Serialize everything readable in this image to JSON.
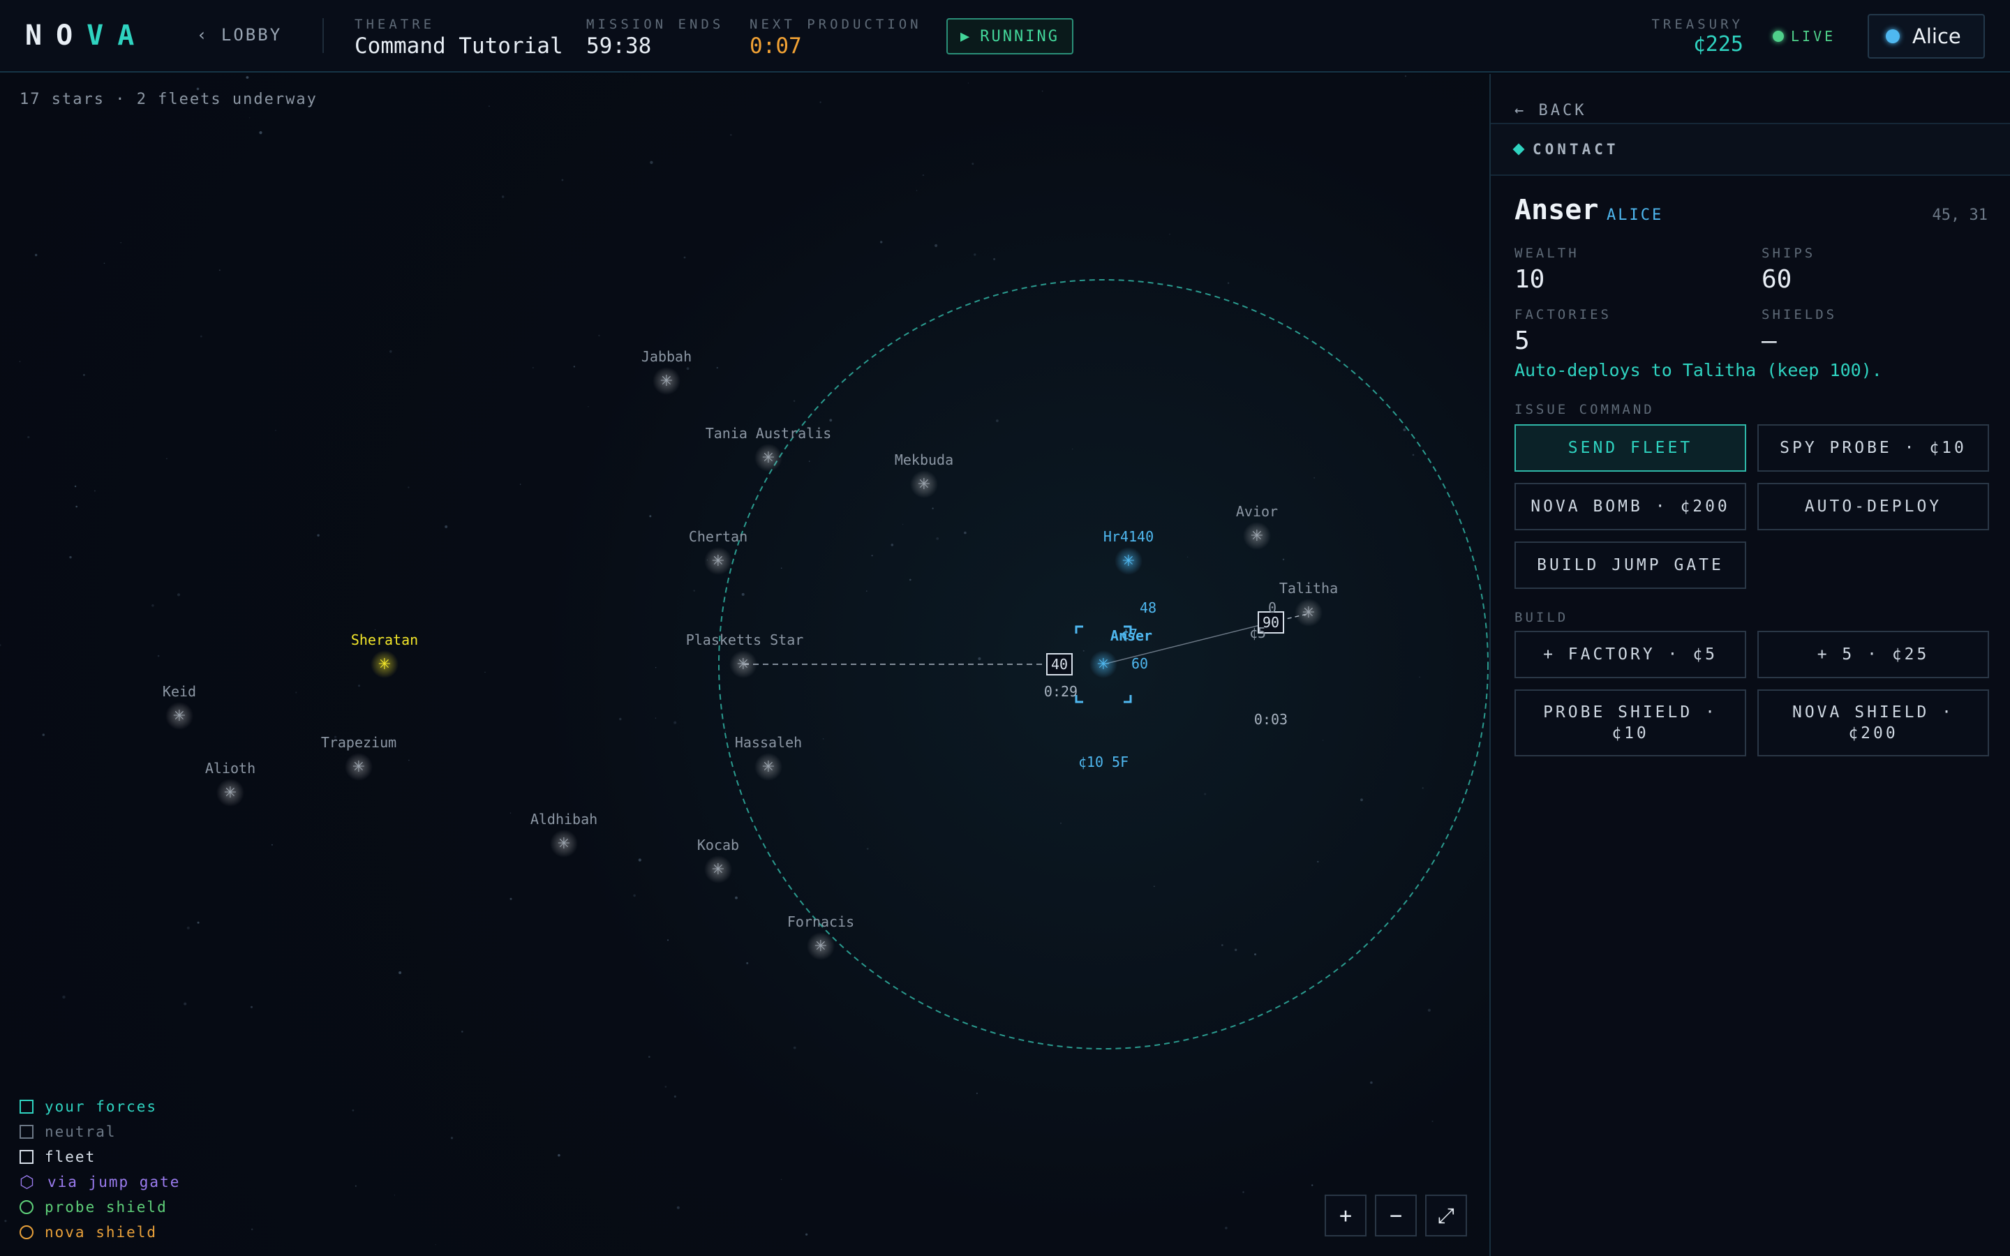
{
  "header": {
    "logo_a": "NO",
    "logo_b": "VA",
    "lobby_label": "‹ LOBBY",
    "theatre_label": "THEATRE",
    "theatre_value": "Command Tutorial",
    "mission_label": "MISSION ENDS",
    "mission_value": "59:38",
    "production_label": "NEXT PRODUCTION",
    "production_value": "0:07",
    "running_icon": "▶",
    "running_label": "RUNNING",
    "treasury_label": "TREASURY",
    "treasury_value": "¢225",
    "live_label": "LIVE",
    "user_name": "Alice"
  },
  "map": {
    "summary": "17 stars · 2 fleets underway",
    "stars": [
      {
        "name": "Jabbah"
      },
      {
        "name": "Tania Australis"
      },
      {
        "name": "Mekbuda"
      },
      {
        "name": "Chertan"
      },
      {
        "name": "Hr4140",
        "ships": "48",
        "wealth": "¢7"
      },
      {
        "name": "Avior",
        "ships": "0",
        "wealth": "¢5"
      },
      {
        "name": "Talitha"
      },
      {
        "name": "Sheratan"
      },
      {
        "name": "Plasketts Star"
      },
      {
        "name": "Anser",
        "ships": "60",
        "info": "¢10 5F"
      },
      {
        "name": "Keid"
      },
      {
        "name": "Trapezium"
      },
      {
        "name": "Alioth"
      },
      {
        "name": "Hassaleh"
      },
      {
        "name": "Aldhibah"
      },
      {
        "name": "Kocab"
      },
      {
        "name": "Fornacis"
      }
    ],
    "fleets": [
      {
        "ships": "40",
        "eta": "0:29"
      },
      {
        "ships": "90",
        "eta": "0:03"
      }
    ],
    "legend": [
      {
        "label": "your forces",
        "color": "#2fd3c0",
        "shape": "square"
      },
      {
        "label": "neutral",
        "color": "#6c7886",
        "shape": "square"
      },
      {
        "label": "fleet",
        "color": "#d8e0ea",
        "shape": "square"
      },
      {
        "label": "via jump gate",
        "color": "#9b7cf0",
        "shape": "hexagon"
      },
      {
        "label": "probe shield",
        "color": "#5fd17a",
        "shape": "circle"
      },
      {
        "label": "nova shield",
        "color": "#e8a03a",
        "shape": "circle"
      }
    ],
    "zoom_in": "+",
    "zoom_out": "−",
    "fit": "⤢"
  },
  "panel": {
    "back_label": "← BACK",
    "contact_label": "CONTACT",
    "star_name": "Anser",
    "owner": "ALICE",
    "coords": "45, 31",
    "wealth_label": "WEALTH",
    "wealth": "10",
    "ships_label": "SHIPS",
    "ships": "60",
    "factories_label": "FACTORIES",
    "factories": "5",
    "shields_label": "SHIELDS",
    "shields": "—",
    "auto_note": "Auto-deploys to Talitha (keep 100).",
    "issue_label": "ISSUE COMMAND",
    "send_fleet": "SEND FLEET",
    "spy_probe": "SPY PROBE · ¢10",
    "nova_bomb": "NOVA BOMB · ¢200",
    "auto_deploy": "AUTO-DEPLOY",
    "build_jump_gate": "BUILD JUMP GATE",
    "build_label": "BUILD",
    "factory": "+ FACTORY · ¢5",
    "plus_five": "+ 5 · ¢25",
    "probe_shield": "PROBE SHIELD · ¢10",
    "nova_shield": "NOVA SHIELD · ¢200"
  },
  "colors": {
    "accent": "#2fd3c0",
    "own_star": "#4fb8f0",
    "neutral_star": "#9aa3ad",
    "sheratan": "#f2e62a",
    "production": "#f2a234"
  }
}
